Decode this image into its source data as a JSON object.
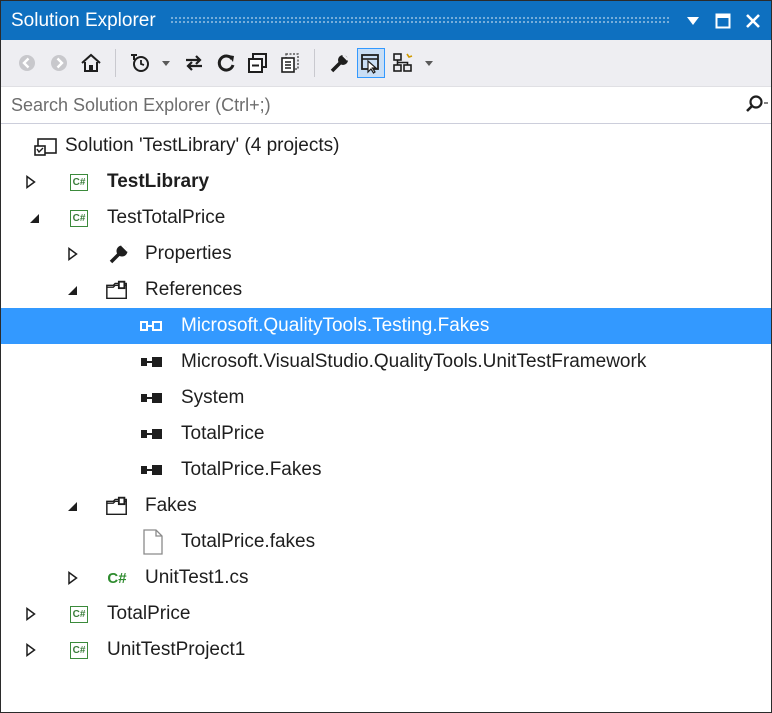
{
  "window": {
    "title": "Solution Explorer",
    "pin_icon": "dropdown-triangle-icon",
    "maximize_icon": "maximize-icon",
    "close_icon": "close-icon"
  },
  "toolbar": {
    "buttons": [
      "back-icon",
      "forward-icon",
      "home-icon",
      "pending-changes-filter-icon",
      "dropdown-arrow",
      "sync-with-active-document-icon",
      "refresh-icon",
      "collapse-all-icon",
      "show-all-files-icon",
      "properties-icon",
      "preview-selected-items-icon",
      "class-view-icon",
      "dropdown-arrow"
    ],
    "active": "preview-selected-items-icon"
  },
  "search": {
    "placeholder": "Search Solution Explorer (Ctrl+;)",
    "icon": "search-icon"
  },
  "tree": {
    "solution": {
      "label": "Solution 'TestLibrary' (4 projects)",
      "icon": "solution-icon"
    },
    "projects": [
      {
        "label": "TestLibrary",
        "bold": true,
        "expanded": false,
        "icon": "csharp-project-icon"
      },
      {
        "label": "TestTotalPrice",
        "bold": false,
        "expanded": true,
        "icon": "csharp-project-icon",
        "children": {
          "properties": {
            "label": "Properties",
            "icon": "wrench-icon",
            "expanded": false
          },
          "references": {
            "label": "References",
            "icon": "references-folder-icon",
            "expanded": true,
            "items": [
              {
                "label": "Microsoft.QualityTools.Testing.Fakes",
                "selected": true,
                "icon": "assembly-reference-icon"
              },
              {
                "label": "Microsoft.VisualStudio.QualityTools.UnitTestFramework",
                "selected": false,
                "icon": "assembly-reference-icon"
              },
              {
                "label": "System",
                "selected": false,
                "icon": "assembly-reference-icon"
              },
              {
                "label": "TotalPrice",
                "selected": false,
                "icon": "assembly-reference-icon"
              },
              {
                "label": "TotalPrice.Fakes",
                "selected": false,
                "icon": "assembly-reference-icon"
              }
            ]
          },
          "fakes": {
            "label": "Fakes",
            "icon": "folder-icon",
            "expanded": true,
            "items": [
              {
                "label": "TotalPrice.fakes",
                "icon": "file-icon"
              }
            ]
          },
          "file": {
            "label": "UnitTest1.cs",
            "icon": "csharp-file-icon",
            "icon_text": "C#",
            "expanded": false
          }
        }
      },
      {
        "label": "TotalPrice",
        "bold": false,
        "expanded": false,
        "icon": "csharp-project-icon"
      },
      {
        "label": "UnitTestProject1",
        "bold": false,
        "expanded": false,
        "icon": "csharp-project-icon"
      }
    ],
    "project_icon_text": "C#"
  },
  "colors": {
    "titlebar": "#0e70c0",
    "toolbar": "#eeeef2",
    "selection": "#3399ff",
    "active_tool": "#c9def5",
    "csharp_green": "#3b8a3b"
  }
}
